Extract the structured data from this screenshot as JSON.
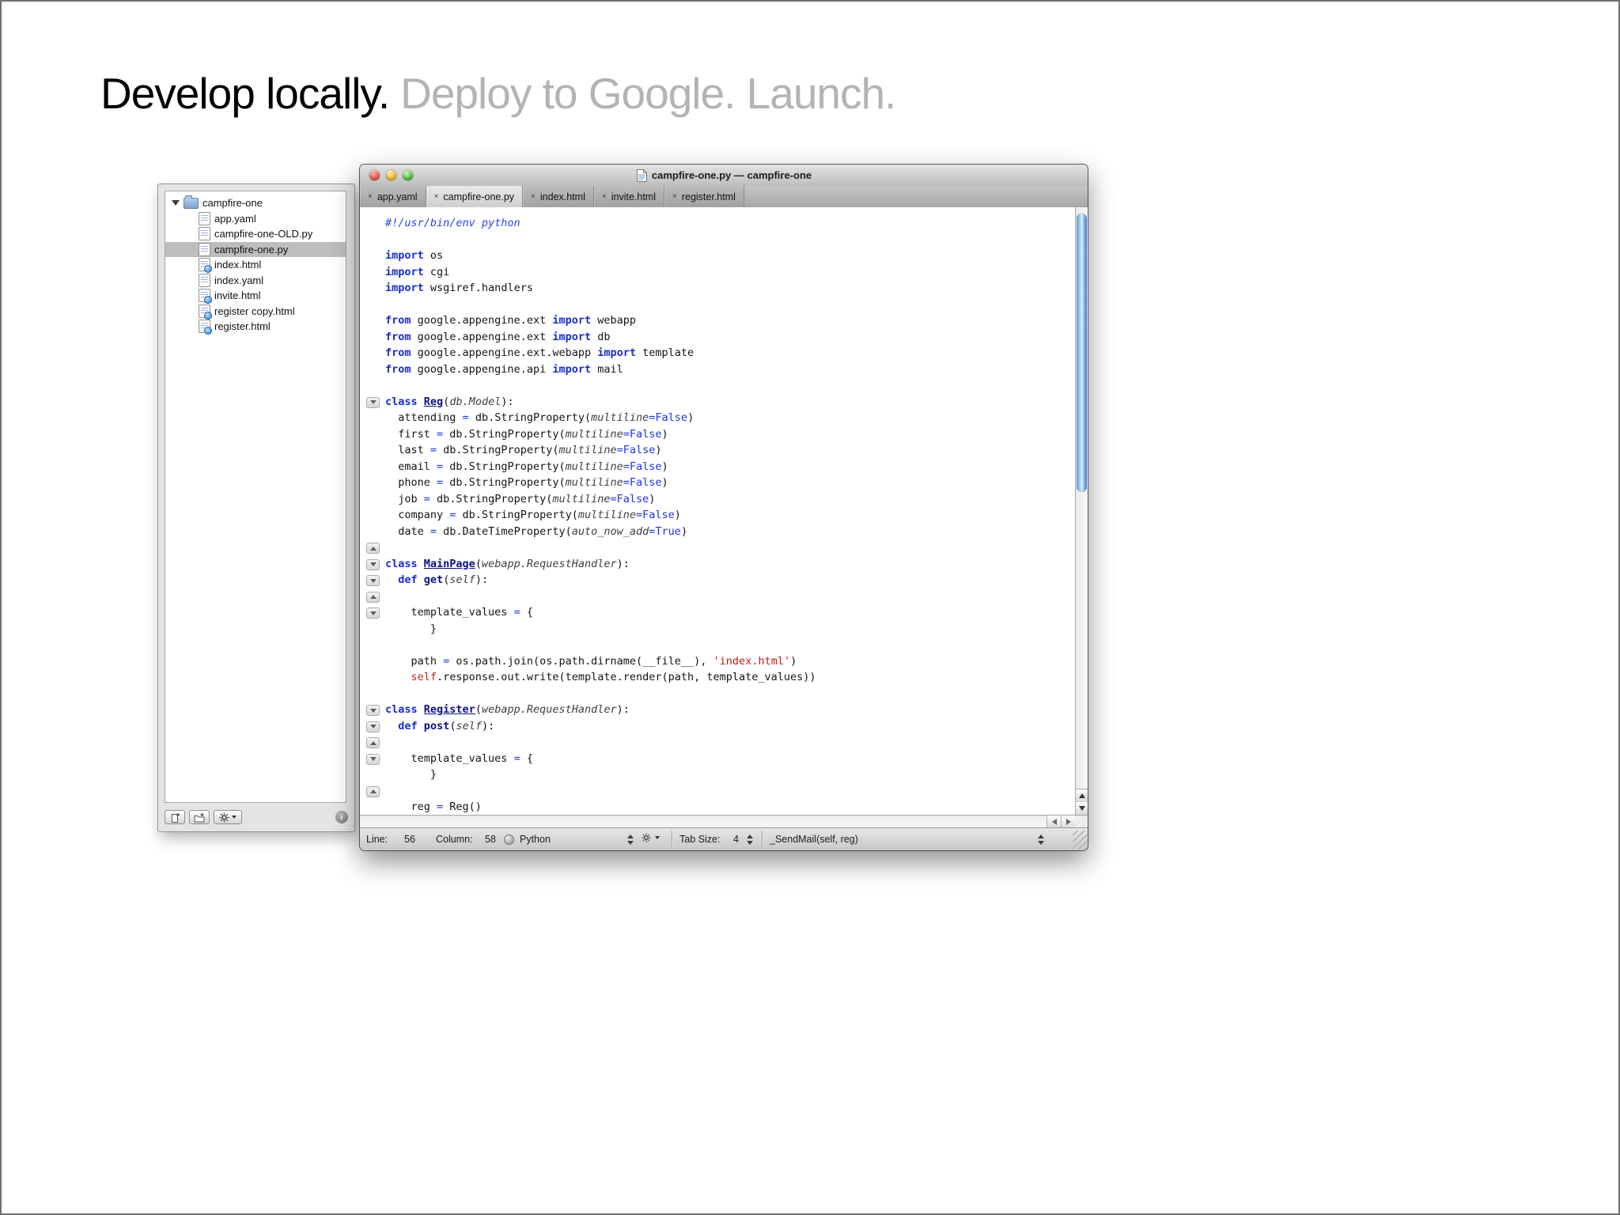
{
  "slide": {
    "title_primary": "Develop locally.",
    "title_secondary": "Deploy to Google. Launch."
  },
  "colors": {
    "kw": "#1b2bd0",
    "comment": "#2745ee",
    "bool": "#2033dd",
    "string": "#c41a16",
    "self": "#cb2213",
    "clsname": "#0a1283",
    "param": "#3f3f3f",
    "op": "#2033dd",
    "sel": "#bdbdbd",
    "thumb": "#4a90d9"
  },
  "drawer": {
    "root_label": "campfire-one",
    "info_glyph": "i",
    "items": [
      {
        "label": "app.yaml",
        "icon": "doc"
      },
      {
        "label": "campfire-one-OLD.py",
        "icon": "doc"
      },
      {
        "label": "campfire-one.py",
        "icon": "doc",
        "selected": true
      },
      {
        "label": "index.html",
        "icon": "html"
      },
      {
        "label": "index.yaml",
        "icon": "doc"
      },
      {
        "label": "invite.html",
        "icon": "html"
      },
      {
        "label": "register copy.html",
        "icon": "html"
      },
      {
        "label": "register.html",
        "icon": "html"
      }
    ]
  },
  "editor_window": {
    "title": "campfire-one.py — campfire-one",
    "close_glyph": "×",
    "tabs": [
      {
        "label": "app.yaml"
      },
      {
        "label": "campfire-one.py",
        "active": true
      },
      {
        "label": "index.html"
      },
      {
        "label": "invite.html"
      },
      {
        "label": "register.html"
      }
    ]
  },
  "status_bar": {
    "line_label": "Line:",
    "line_value": "56",
    "column_label": "Column:",
    "column_value": "58",
    "language": "Python",
    "tab_size_label": "Tab Size:",
    "tab_size_value": "4",
    "symbol": "_SendMail(self, reg)"
  },
  "code": {
    "lines": [
      {
        "fold": null,
        "tokens": [
          [
            "c",
            "#!/usr/bin/env python"
          ]
        ]
      },
      {
        "fold": null,
        "tokens": []
      },
      {
        "fold": null,
        "tokens": [
          [
            "k",
            "import"
          ],
          [
            "t",
            " os"
          ]
        ]
      },
      {
        "fold": null,
        "tokens": [
          [
            "k",
            "import"
          ],
          [
            "t",
            " cgi"
          ]
        ]
      },
      {
        "fold": null,
        "tokens": [
          [
            "k",
            "import"
          ],
          [
            "t",
            " wsgiref.handlers"
          ]
        ]
      },
      {
        "fold": null,
        "tokens": []
      },
      {
        "fold": null,
        "tokens": [
          [
            "k",
            "from"
          ],
          [
            "t",
            " google.appengine.ext "
          ],
          [
            "k",
            "import"
          ],
          [
            "t",
            " webapp"
          ]
        ]
      },
      {
        "fold": null,
        "tokens": [
          [
            "k",
            "from"
          ],
          [
            "t",
            " google.appengine.ext "
          ],
          [
            "k",
            "import"
          ],
          [
            "t",
            " db"
          ]
        ]
      },
      {
        "fold": null,
        "tokens": [
          [
            "k",
            "from"
          ],
          [
            "t",
            " google.appengine.ext.webapp "
          ],
          [
            "k",
            "import"
          ],
          [
            "t",
            " template"
          ]
        ]
      },
      {
        "fold": null,
        "tokens": [
          [
            "k",
            "from"
          ],
          [
            "t",
            " google.appengine.api "
          ],
          [
            "k",
            "import"
          ],
          [
            "t",
            " mail"
          ]
        ]
      },
      {
        "fold": null,
        "tokens": []
      },
      {
        "fold": "down",
        "tokens": [
          [
            "k",
            "class"
          ],
          [
            "t",
            " "
          ],
          [
            "cls",
            "Reg"
          ],
          [
            "t",
            "("
          ],
          [
            "it",
            "db.Model"
          ],
          [
            "t",
            "):"
          ]
        ]
      },
      {
        "fold": null,
        "tokens": [
          [
            "t",
            "  attending "
          ],
          [
            "op",
            "="
          ],
          [
            "t",
            " db.StringProperty("
          ],
          [
            "it",
            "multiline"
          ],
          [
            "op",
            "="
          ],
          [
            "b",
            "False"
          ],
          [
            "t",
            ")"
          ]
        ]
      },
      {
        "fold": null,
        "tokens": [
          [
            "t",
            "  first "
          ],
          [
            "op",
            "="
          ],
          [
            "t",
            " db.StringProperty("
          ],
          [
            "it",
            "multiline"
          ],
          [
            "op",
            "="
          ],
          [
            "b",
            "False"
          ],
          [
            "t",
            ")"
          ]
        ]
      },
      {
        "fold": null,
        "tokens": [
          [
            "t",
            "  last "
          ],
          [
            "op",
            "="
          ],
          [
            "t",
            " db.StringProperty("
          ],
          [
            "it",
            "multiline"
          ],
          [
            "op",
            "="
          ],
          [
            "b",
            "False"
          ],
          [
            "t",
            ")"
          ]
        ]
      },
      {
        "fold": null,
        "tokens": [
          [
            "t",
            "  email "
          ],
          [
            "op",
            "="
          ],
          [
            "t",
            " db.StringProperty("
          ],
          [
            "it",
            "multiline"
          ],
          [
            "op",
            "="
          ],
          [
            "b",
            "False"
          ],
          [
            "t",
            ")"
          ]
        ]
      },
      {
        "fold": null,
        "tokens": [
          [
            "t",
            "  phone "
          ],
          [
            "op",
            "="
          ],
          [
            "t",
            " db.StringProperty("
          ],
          [
            "it",
            "multiline"
          ],
          [
            "op",
            "="
          ],
          [
            "b",
            "False"
          ],
          [
            "t",
            ")"
          ]
        ]
      },
      {
        "fold": null,
        "tokens": [
          [
            "t",
            "  job "
          ],
          [
            "op",
            "="
          ],
          [
            "t",
            " db.StringProperty("
          ],
          [
            "it",
            "multiline"
          ],
          [
            "op",
            "="
          ],
          [
            "b",
            "False"
          ],
          [
            "t",
            ")"
          ]
        ]
      },
      {
        "fold": null,
        "tokens": [
          [
            "t",
            "  company "
          ],
          [
            "op",
            "="
          ],
          [
            "t",
            " db.StringProperty("
          ],
          [
            "it",
            "multiline"
          ],
          [
            "op",
            "="
          ],
          [
            "b",
            "False"
          ],
          [
            "t",
            ")"
          ]
        ]
      },
      {
        "fold": null,
        "tokens": [
          [
            "t",
            "  date "
          ],
          [
            "op",
            "="
          ],
          [
            "t",
            " db.DateTimeProperty("
          ],
          [
            "it",
            "auto_now_add"
          ],
          [
            "op",
            "="
          ],
          [
            "b",
            "True"
          ],
          [
            "t",
            ")"
          ]
        ]
      },
      {
        "fold": "up",
        "tokens": []
      },
      {
        "fold": "down",
        "tokens": [
          [
            "k",
            "class"
          ],
          [
            "t",
            " "
          ],
          [
            "cls",
            "MainPage"
          ],
          [
            "t",
            "("
          ],
          [
            "it",
            "webapp.RequestHandler"
          ],
          [
            "t",
            "):"
          ]
        ]
      },
      {
        "fold": "down",
        "tokens": [
          [
            "t",
            "  "
          ],
          [
            "k",
            "def"
          ],
          [
            "t",
            " "
          ],
          [
            "fn",
            "get"
          ],
          [
            "t",
            "("
          ],
          [
            "it",
            "self"
          ],
          [
            "t",
            "):"
          ]
        ]
      },
      {
        "fold": "up",
        "tokens": []
      },
      {
        "fold": "down",
        "tokens": [
          [
            "t",
            "    template_values "
          ],
          [
            "op",
            "="
          ],
          [
            "t",
            " {"
          ]
        ]
      },
      {
        "fold": null,
        "tokens": [
          [
            "t",
            "       }"
          ]
        ]
      },
      {
        "fold": null,
        "tokens": []
      },
      {
        "fold": null,
        "tokens": [
          [
            "t",
            "    path "
          ],
          [
            "op",
            "="
          ],
          [
            "t",
            " os.path.join(os.path.dirname(__file__), "
          ],
          [
            "s",
            "'index.html'"
          ],
          [
            "t",
            ")"
          ]
        ]
      },
      {
        "fold": null,
        "tokens": [
          [
            "t",
            "    "
          ],
          [
            "slf",
            "self"
          ],
          [
            "t",
            ".response.out.write(template.render(path, template_values))"
          ]
        ]
      },
      {
        "fold": null,
        "tokens": []
      },
      {
        "fold": "down",
        "tokens": [
          [
            "k",
            "class"
          ],
          [
            "t",
            " "
          ],
          [
            "cls",
            "Register"
          ],
          [
            "t",
            "("
          ],
          [
            "it",
            "webapp.RequestHandler"
          ],
          [
            "t",
            "):"
          ]
        ]
      },
      {
        "fold": "down",
        "tokens": [
          [
            "t",
            "  "
          ],
          [
            "k",
            "def"
          ],
          [
            "t",
            " "
          ],
          [
            "fn",
            "post"
          ],
          [
            "t",
            "("
          ],
          [
            "it",
            "self"
          ],
          [
            "t",
            "):"
          ]
        ]
      },
      {
        "fold": "up",
        "tokens": []
      },
      {
        "fold": "down",
        "tokens": [
          [
            "t",
            "    template_values "
          ],
          [
            "op",
            "="
          ],
          [
            "t",
            " {"
          ]
        ]
      },
      {
        "fold": null,
        "tokens": [
          [
            "t",
            "       }"
          ]
        ]
      },
      {
        "fold": "up",
        "tokens": []
      },
      {
        "fold": null,
        "tokens": [
          [
            "t",
            "    reg "
          ],
          [
            "op",
            "="
          ],
          [
            "t",
            " Reg()"
          ]
        ]
      }
    ]
  }
}
